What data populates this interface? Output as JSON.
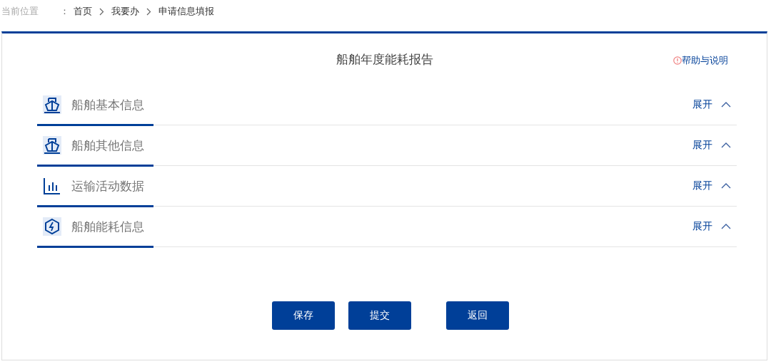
{
  "breadcrumb": {
    "label": "当前位置",
    "separator": "：",
    "items": [
      "首页",
      "我要办",
      "申请信息填报"
    ]
  },
  "title": "船舶年度能耗报告",
  "help": "帮助与说明",
  "sections": [
    {
      "kind": "ship",
      "title": "船舶基本信息",
      "toggle": "展开"
    },
    {
      "kind": "ship",
      "title": "船舶其他信息",
      "toggle": "展开"
    },
    {
      "kind": "chart",
      "title": "运输活动数据",
      "toggle": "展开"
    },
    {
      "kind": "energy",
      "title": "船舶能耗信息",
      "toggle": "展开"
    }
  ],
  "actions": [
    "保存",
    "提交"
  ],
  "back_button": "返回"
}
